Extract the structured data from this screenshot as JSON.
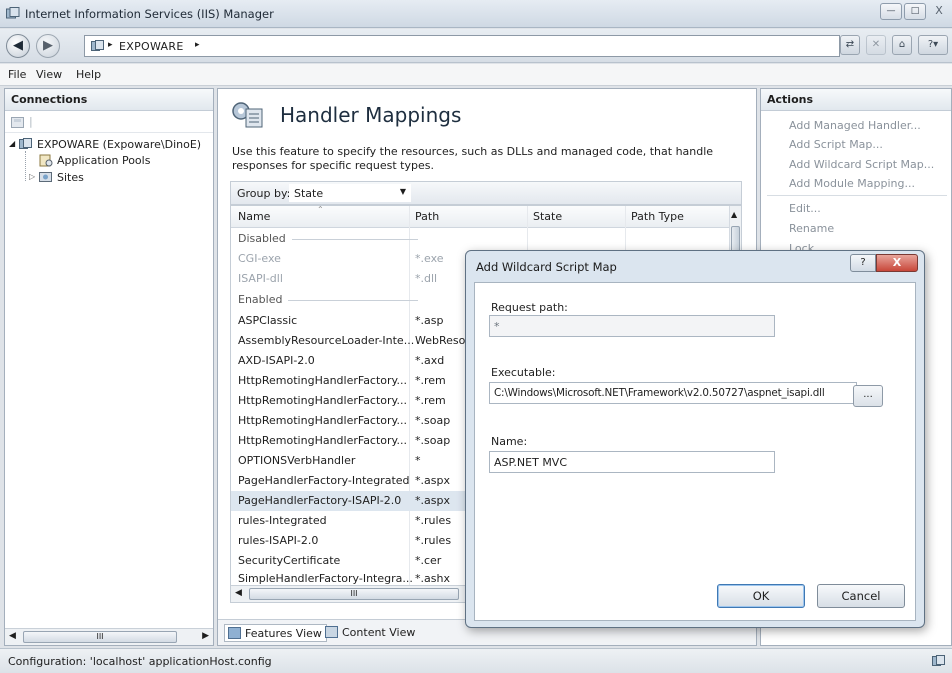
{
  "window": {
    "title": "Internet Information Services (IIS) Manager",
    "buttons": {
      "minimize": "—",
      "maximize": "□",
      "close": "X"
    }
  },
  "address": {
    "separator": "▸",
    "path": "EXPOWARE",
    "trailing": "▸"
  },
  "menu": {
    "file": "File",
    "view": "View",
    "help": "Help"
  },
  "connections": {
    "header": "Connections",
    "root": "EXPOWARE (Expoware\\DinoE)",
    "children": [
      "Application Pools",
      "Sites"
    ]
  },
  "handler_mappings": {
    "title": "Handler Mappings",
    "description": "Use this feature to specify the resources, such as DLLs and managed code, that handle responses for specific request types.",
    "group_by_label": "Group by:",
    "group_by_value": "State",
    "columns": [
      "Name",
      "Path",
      "State",
      "Path Type"
    ],
    "groups": {
      "disabled": "Disabled",
      "enabled": "Enabled"
    },
    "disabled_rows": [
      {
        "name": "CGI-exe",
        "path": "*.exe"
      },
      {
        "name": "ISAPI-dll",
        "path": "*.dll"
      }
    ],
    "enabled_rows": [
      {
        "name": "ASPClassic",
        "path": "*.asp"
      },
      {
        "name": "AssemblyResourceLoader-Inte...",
        "path": "WebResou"
      },
      {
        "name": "AXD-ISAPI-2.0",
        "path": "*.axd"
      },
      {
        "name": "HttpRemotingHandlerFactory...",
        "path": "*.rem"
      },
      {
        "name": "HttpRemotingHandlerFactory...",
        "path": "*.rem"
      },
      {
        "name": "HttpRemotingHandlerFactory...",
        "path": "*.soap"
      },
      {
        "name": "HttpRemotingHandlerFactory...",
        "path": "*.soap"
      },
      {
        "name": "OPTIONSVerbHandler",
        "path": "*"
      },
      {
        "name": "PageHandlerFactory-Integrated",
        "path": "*.aspx"
      },
      {
        "name": "PageHandlerFactory-ISAPI-2.0",
        "path": "*.aspx"
      },
      {
        "name": "rules-Integrated",
        "path": "*.rules"
      },
      {
        "name": "rules-ISAPI-2.0",
        "path": "*.rules"
      },
      {
        "name": "SecurityCertificate",
        "path": "*.cer"
      },
      {
        "name": "SimpleHandlerFactory-Integra...",
        "path": "*.ashx"
      }
    ],
    "scroll_glyph": "III",
    "tabs": {
      "features": "Features View",
      "content": "Content View"
    }
  },
  "actions": {
    "header": "Actions",
    "items": [
      "Add Managed Handler...",
      "Add Script Map...",
      "Add Wildcard Script Map...",
      "Add Module Mapping...",
      "Edit...",
      "Rename",
      "Lock"
    ]
  },
  "status": {
    "text": "Configuration: 'localhost' applicationHost.config"
  },
  "dialog": {
    "title": "Add Wildcard Script Map",
    "help": "?",
    "close": "X",
    "request_path_label": "Request path:",
    "request_path_value": "*",
    "executable_label": "Executable:",
    "executable_value": "C:\\Windows\\Microsoft.NET\\Framework\\v2.0.50727\\aspnet_isapi.dll",
    "browse": "...",
    "name_label": "Name:",
    "name_value": "ASP.NET MVC",
    "ok": "OK",
    "cancel": "Cancel"
  }
}
